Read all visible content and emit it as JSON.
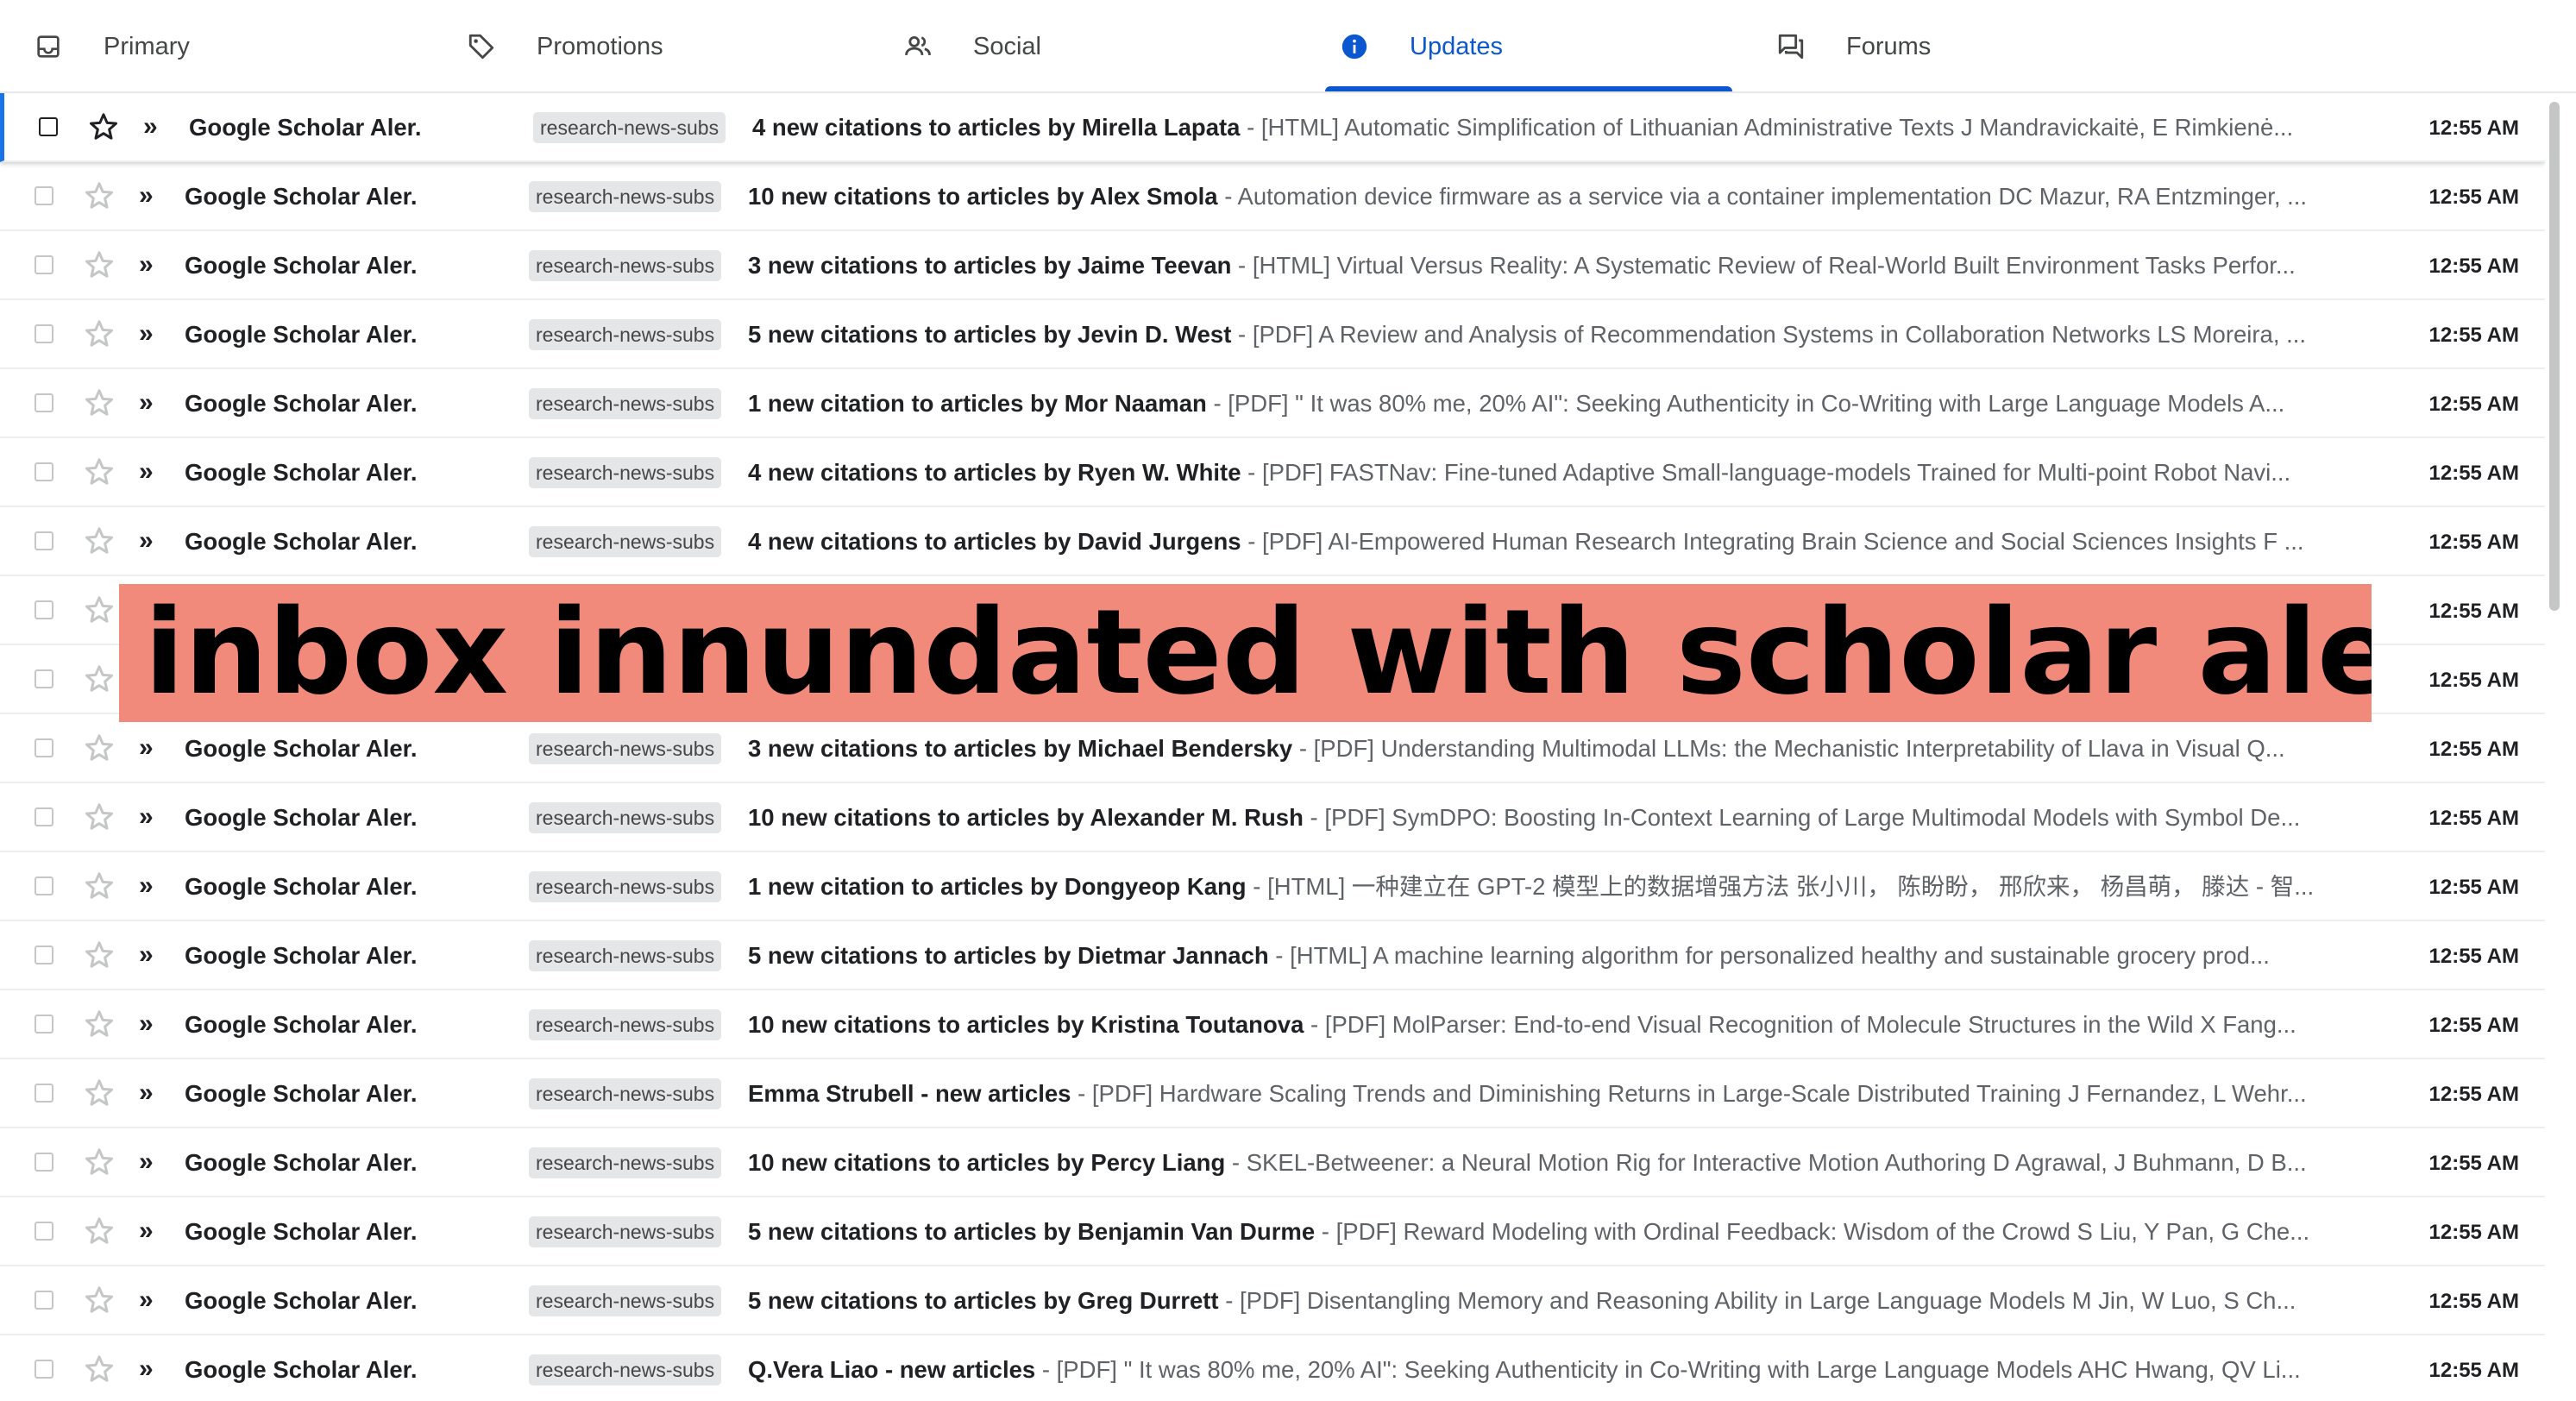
{
  "tabs": [
    {
      "label": "Primary",
      "icon": "inbox-icon"
    },
    {
      "label": "Promotions",
      "icon": "tag-icon"
    },
    {
      "label": "Social",
      "icon": "people-icon"
    },
    {
      "label": "Updates",
      "icon": "info-icon"
    },
    {
      "label": "Forums",
      "icon": "forum-icon"
    }
  ],
  "active_tab": "Updates",
  "colors": {
    "accent": "#0b57d0",
    "banner": "#f28a7b",
    "label_bg": "#e4e6e8"
  },
  "emails": [
    {
      "sender": "Google Scholar Aler.",
      "label": "research-news-subs",
      "subject": "4 new citations to articles by Mirella Lapata",
      "snippet": "[HTML] Automatic Simplification of Lithuanian Administrative Texts J Mandravickaitė, E Rimkienė...",
      "time": "12:55 AM"
    },
    {
      "sender": "Google Scholar Aler.",
      "label": "research-news-subs",
      "subject": "10 new citations to articles by Alex Smola",
      "snippet": "Automation device firmware as a service via a container implementation DC Mazur, RA Entzminger, ...",
      "time": "12:55 AM"
    },
    {
      "sender": "Google Scholar Aler.",
      "label": "research-news-subs",
      "subject": "3 new citations to articles by Jaime Teevan",
      "snippet": "[HTML] Virtual Versus Reality: A Systematic Review of Real-World Built Environment Tasks Perfor...",
      "time": "12:55 AM"
    },
    {
      "sender": "Google Scholar Aler.",
      "label": "research-news-subs",
      "subject": "5 new citations to articles by Jevin D. West",
      "snippet": "[PDF] A Review and Analysis of Recommendation Systems in Collaboration Networks LS Moreira, ...",
      "time": "12:55 AM"
    },
    {
      "sender": "Google Scholar Aler.",
      "label": "research-news-subs",
      "subject": "1 new citation to articles by Mor Naaman",
      "snippet": "[PDF] \" It was 80% me, 20% AI\": Seeking Authenticity in Co-Writing with Large Language Models A...",
      "time": "12:55 AM"
    },
    {
      "sender": "Google Scholar Aler.",
      "label": "research-news-subs",
      "subject": "4 new citations to articles by Ryen W. White",
      "snippet": "[PDF] FASTNav: Fine-tuned Adaptive Small-language-models Trained for Multi-point Robot Navi...",
      "time": "12:55 AM"
    },
    {
      "sender": "Google Scholar Aler.",
      "label": "research-news-subs",
      "subject": "4 new citations to articles by David Jurgens",
      "snippet": "[PDF] AI-Empowered Human Research Integrating Brain Science and Social Sciences Insights F ...",
      "time": "12:55 AM"
    },
    {
      "sender": "",
      "label": "",
      "subject": "",
      "snippet": "",
      "time": "12:55 AM"
    },
    {
      "sender": "",
      "label": "",
      "subject": "",
      "snippet": "",
      "time": "12:55 AM"
    },
    {
      "sender": "Google Scholar Aler.",
      "label": "research-news-subs",
      "subject": "3 new citations to articles by Michael Bendersky",
      "snippet": "[PDF] Understanding Multimodal LLMs: the Mechanistic Interpretability of Llava in Visual Q...",
      "time": "12:55 AM"
    },
    {
      "sender": "Google Scholar Aler.",
      "label": "research-news-subs",
      "subject": "10 new citations to articles by Alexander M. Rush",
      "snippet": "[PDF] SymDPO: Boosting In-Context Learning of Large Multimodal Models with Symbol De...",
      "time": "12:55 AM"
    },
    {
      "sender": "Google Scholar Aler.",
      "label": "research-news-subs",
      "subject": "1 new citation to articles by Dongyeop Kang",
      "snippet": "[HTML] 一种建立在 GPT-2 模型上的数据增强方法 张小川， 陈盼盼， 邢欣来， 杨昌萌， 滕达 - 智...",
      "time": "12:55 AM"
    },
    {
      "sender": "Google Scholar Aler.",
      "label": "research-news-subs",
      "subject": "5 new citations to articles by Dietmar Jannach",
      "snippet": "[HTML] A machine learning algorithm for personalized healthy and sustainable grocery prod...",
      "time": "12:55 AM"
    },
    {
      "sender": "Google Scholar Aler.",
      "label": "research-news-subs",
      "subject": "10 new citations to articles by Kristina Toutanova",
      "snippet": "[PDF] MolParser: End-to-end Visual Recognition of Molecule Structures in the Wild X Fang...",
      "time": "12:55 AM"
    },
    {
      "sender": "Google Scholar Aler.",
      "label": "research-news-subs",
      "subject": "Emma Strubell - new articles",
      "snippet": "[PDF] Hardware Scaling Trends and Diminishing Returns in Large-Scale Distributed Training J Fernandez, L Wehr...",
      "time": "12:55 AM"
    },
    {
      "sender": "Google Scholar Aler.",
      "label": "research-news-subs",
      "subject": "10 new citations to articles by Percy Liang",
      "snippet": "SKEL-Betweener: a Neural Motion Rig for Interactive Motion Authoring D Agrawal, J Buhmann, D B...",
      "time": "12:55 AM"
    },
    {
      "sender": "Google Scholar Aler.",
      "label": "research-news-subs",
      "subject": "5 new citations to articles by Benjamin Van Durme",
      "snippet": "[PDF] Reward Modeling with Ordinal Feedback: Wisdom of the Crowd S Liu, Y Pan, G Che...",
      "time": "12:55 AM"
    },
    {
      "sender": "Google Scholar Aler.",
      "label": "research-news-subs",
      "subject": "5 new citations to articles by Greg Durrett",
      "snippet": "[PDF] Disentangling Memory and Reasoning Ability in Large Language Models M Jin, W Luo, S Ch...",
      "time": "12:55 AM"
    },
    {
      "sender": "Google Scholar Aler.",
      "label": "research-news-subs",
      "subject": "Q.Vera Liao - new articles",
      "snippet": "[PDF] \" It was 80% me, 20% AI\": Seeking Authenticity in Co-Writing with Large Language Models AHC Hwang, QV Li...",
      "time": "12:55 AM"
    }
  ],
  "banner": {
    "text": "My inbox innundated with scholar alerts"
  }
}
